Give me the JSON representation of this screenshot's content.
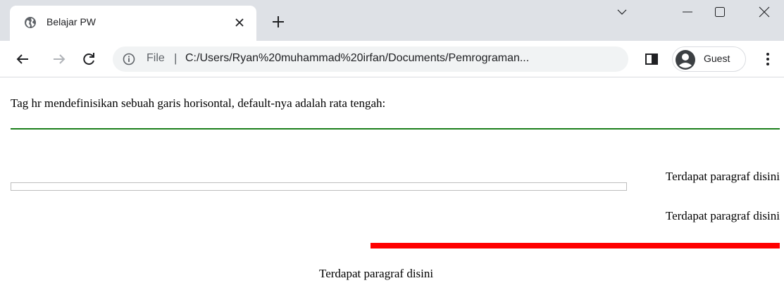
{
  "browser": {
    "tab": {
      "title": "Belajar PW"
    },
    "toolbar": {
      "omnibox": {
        "scheme_label": "File",
        "separator": "|",
        "url": "C:/Users/Ryan%20muhammad%20irfan/Documents/Pemrograman..."
      },
      "profile_label": "Guest"
    }
  },
  "page": {
    "intro": "Tag hr mendefinisikan sebuah garis horisontal, default-nya adalah rata tengah:",
    "paragraphs": [
      "Terdapat paragraf disini",
      "Terdapat paragraf disini",
      "Terdapat paragraf disini"
    ],
    "rules": [
      {
        "color": "#1a7f1a",
        "style": "solid"
      },
      {
        "color": "#bdbdbd",
        "style": "outlined"
      },
      {
        "color": "#ff0000",
        "style": "solid"
      }
    ]
  }
}
